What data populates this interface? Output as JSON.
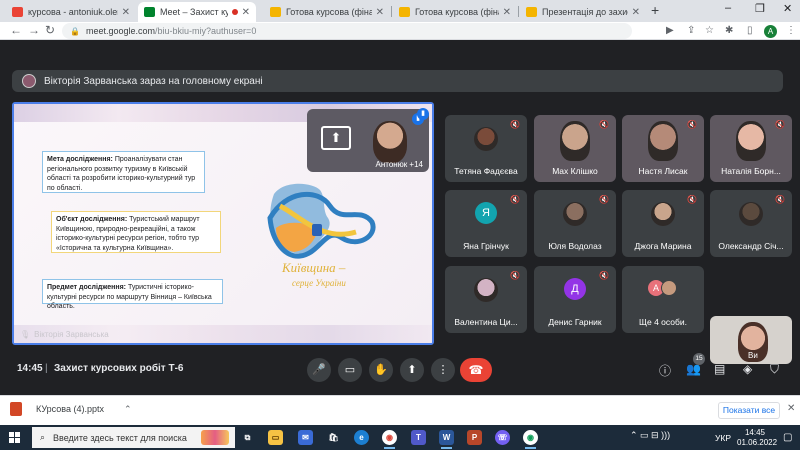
{
  "browser": {
    "tabs": [
      {
        "title": "курсова - antoniuk.olena@",
        "favicon_color": "#ea4335",
        "active": false
      },
      {
        "title": "Meet – Захист курсових",
        "favicon_color": "#00832d",
        "active": true
      },
      {
        "title": "Готова курсова (фінальні",
        "favicon_color": "#f4b400",
        "active": false
      },
      {
        "title": "Готова курсова (фінальні",
        "favicon_color": "#f4b400",
        "active": false
      },
      {
        "title": "Презентація до захисту кур",
        "favicon_color": "#f4b400",
        "active": false
      }
    ],
    "new_tab": "+",
    "window_controls": [
      "–",
      "❐",
      "✕"
    ],
    "url_host": "meet.google.com",
    "url_path": "/biu-bkiu-miy?authuser=0",
    "profile_initial": "A"
  },
  "meet": {
    "presenting_banner": "Вікторія Зарванська зараз на головному екрані",
    "slide": {
      "box1_title": "Мета дослідження:",
      "box1_text": " Проаналізувати стан регіонального розвитку туризму в Київській області та розробити історико-культурний тур по області.",
      "box2_title": "Об'єкт дослідження:",
      "box2_text": " Туристський маршрут Київщиною, природно-рекреаційні, а також історико-культурні ресурси регіон, тобто тур «Історична та культурна Київщина».",
      "box3_title": "Предмет дослідження:",
      "box3_text": " Туристичні історико-культурні ресурси по маршруту Вінниця – Київська область.",
      "logo_line1": "Київщина –",
      "logo_line2": "серце України",
      "presenter_name": "Вікторія Зарванська"
    },
    "self_tile_label": "Антонюк +14",
    "participants": [
      {
        "name": "Тетяна Фадєєва",
        "kind": "photo",
        "color": "#7a4b3a",
        "initial": ""
      },
      {
        "name": "Max Клішко",
        "kind": "video",
        "color": "#caa48c",
        "initial": ""
      },
      {
        "name": "Настя Лисак",
        "kind": "video",
        "color": "#b58a78",
        "initial": ""
      },
      {
        "name": "Наталія Борн...",
        "kind": "video",
        "color": "#e6b8a5",
        "initial": ""
      },
      {
        "name": "Яна Грінчук",
        "kind": "initial",
        "color": "#12a4af",
        "initial": "Я"
      },
      {
        "name": "Юля Водолаз",
        "kind": "photo",
        "color": "#8b6f60",
        "initial": ""
      },
      {
        "name": "Джога Марина",
        "kind": "photo",
        "color": "#c9a58c",
        "initial": ""
      },
      {
        "name": "Олександр Січ...",
        "kind": "photo",
        "color": "#5b4a3e",
        "initial": ""
      },
      {
        "name": "Валентина Ци...",
        "kind": "photo",
        "color": "#d3b3c4",
        "initial": ""
      },
      {
        "name": "Денис Гарник",
        "kind": "initial",
        "color": "#9334e6",
        "initial": "Д"
      }
    ],
    "more_tile": {
      "label": "Ще 4 особи.",
      "initial": "A"
    },
    "big_tile_name": "Ви"
  },
  "callbar": {
    "time": "14:45",
    "separator": "|",
    "meeting_name": "Захист курсових робіт Т-6",
    "people_count": "15"
  },
  "downloads": {
    "file": "КУрсова (4).pptx",
    "show_all": "Показати все"
  },
  "taskbar": {
    "search_placeholder": "Введите здесь текст для поиска",
    "lang": "УКР",
    "time": "14:45",
    "date": "01.06.2022"
  }
}
